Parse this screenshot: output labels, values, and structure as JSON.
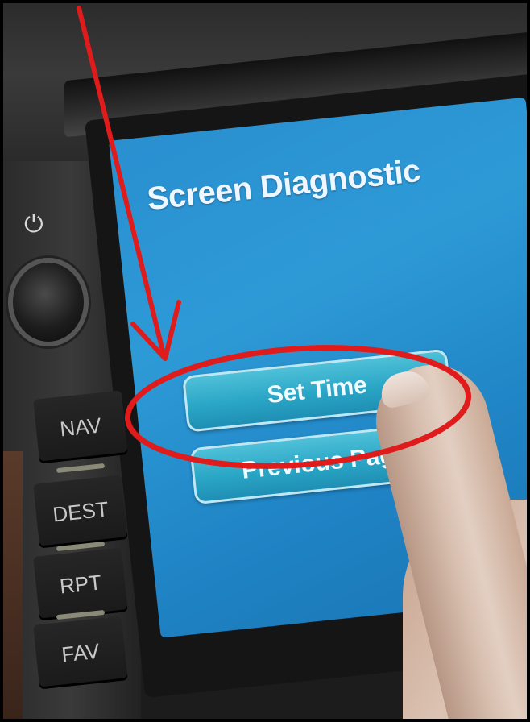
{
  "screen": {
    "title": "Screen Diagnostic",
    "buttons": [
      {
        "label": "Set Time"
      },
      {
        "label": "Previous Page"
      }
    ],
    "background_color": "#2a8fd0"
  },
  "hardware_buttons": [
    {
      "label": "NAV"
    },
    {
      "label": "DEST"
    },
    {
      "label": "RPT"
    },
    {
      "label": "FAV"
    }
  ],
  "icons": {
    "power": "power-icon",
    "knob": "volume-knob"
  },
  "annotation": {
    "color": "#e01b1b",
    "arrow_target": "Set Time",
    "highlight_target": "Set Time"
  }
}
